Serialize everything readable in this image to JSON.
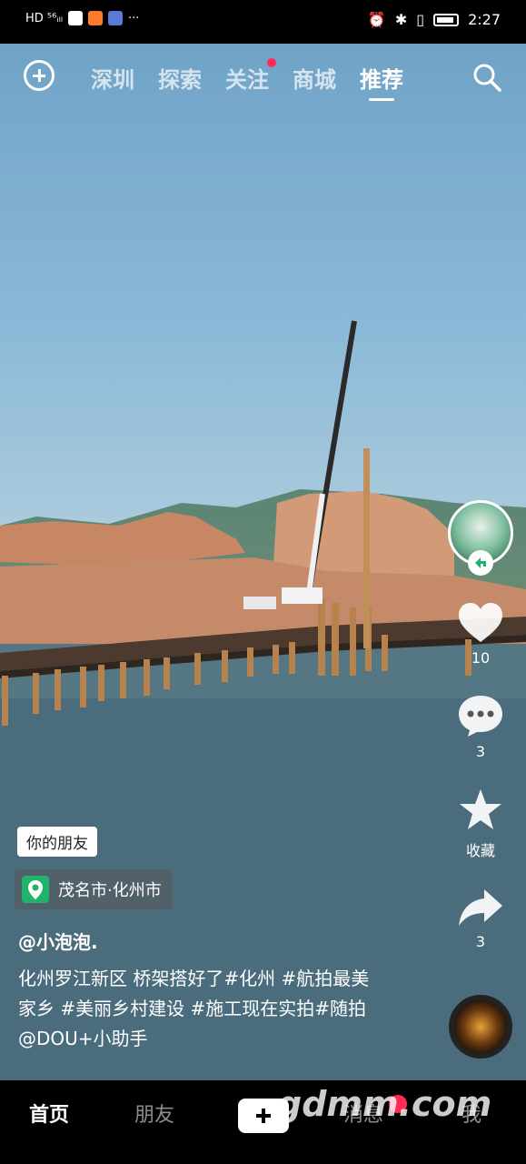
{
  "status_bar": {
    "left_text": "HD ⁵⁶ᵢₗₗ",
    "time": "2:27",
    "more": "···"
  },
  "top_nav": {
    "tabs": [
      {
        "label": "深圳"
      },
      {
        "label": "探索"
      },
      {
        "label": "关注"
      },
      {
        "label": "商城"
      },
      {
        "label": "推荐"
      }
    ],
    "active_tab": "推荐"
  },
  "rail": {
    "likes": "10",
    "comments": "3",
    "favorite_label": "收藏",
    "shares": "3"
  },
  "post": {
    "friend_badge": "你的朋友",
    "location": "茂名市·化州市",
    "author": "@小泡泡.",
    "description": "化州罗江新区 桥架搭好了#化州 #航拍最美家乡 #美丽乡村建设 #施工现在实拍#随拍 @DOU+小助手"
  },
  "bottom_nav": {
    "home": "首页",
    "friends": "朋友",
    "messages": "消息",
    "me": "我"
  },
  "watermark": "gdmm.com",
  "colors": {
    "accent_red": "#ff2d55",
    "location_green": "#1fb36b"
  }
}
